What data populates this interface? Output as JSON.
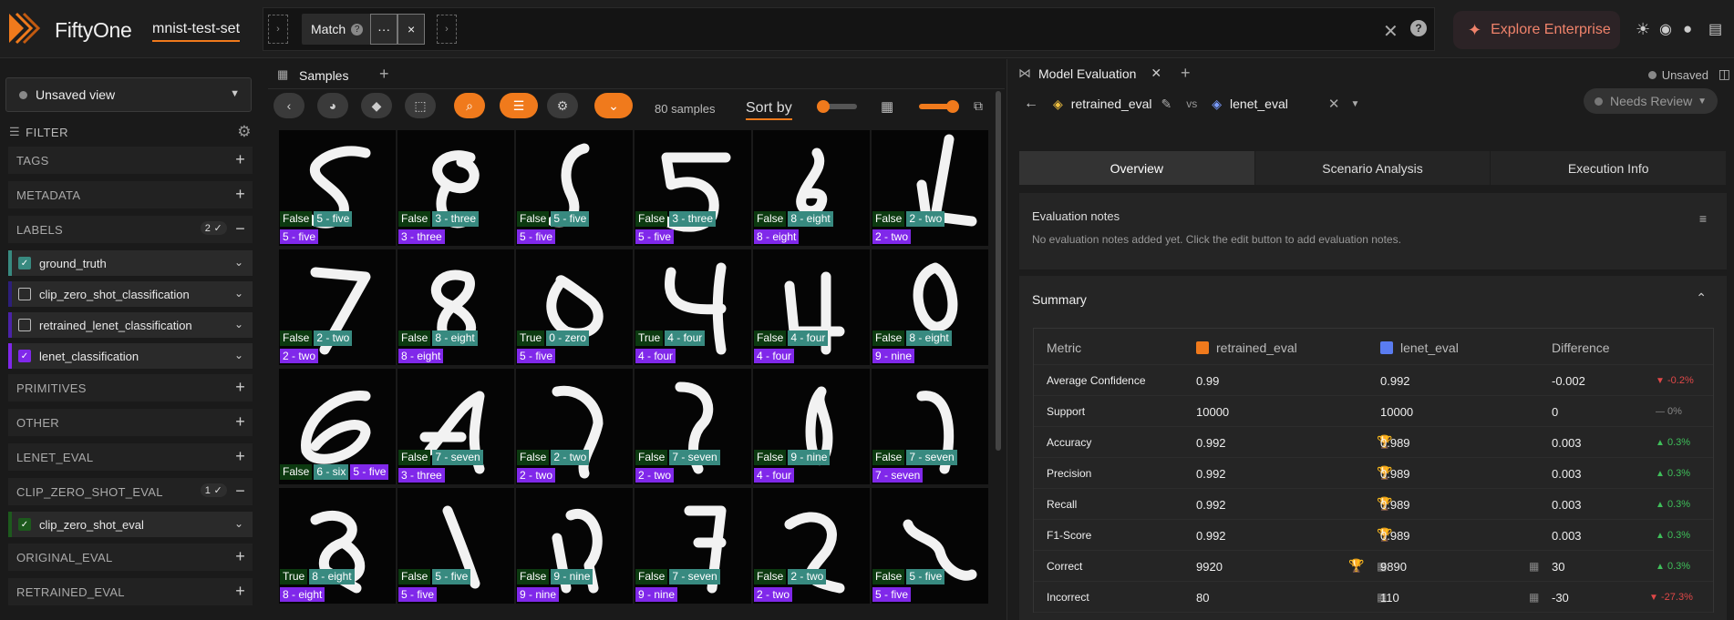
{
  "app": {
    "brand": "FiftyOne",
    "dataset": "mnist-test-set"
  },
  "topbar": {
    "match_label": "Match",
    "more": "···",
    "close": "×",
    "explore": "Explore Enterprise"
  },
  "sidebar": {
    "view": "Unsaved view",
    "filter_label": "FILTER",
    "groups": {
      "tags": "TAGS",
      "metadata": "METADATA",
      "labels": "LABELS",
      "labels_count": "2 ✓",
      "primitives": "PRIMITIVES",
      "other": "OTHER",
      "lenet_eval": "LENET_EVAL",
      "clip_zero_shot_eval": "CLIP_ZERO_SHOT_EVAL",
      "clip_count": "1 ✓",
      "original_eval": "ORIGINAL_EVAL",
      "retrained_eval": "RETRAINED_EVAL"
    },
    "fields": [
      "ground_truth",
      "clip_zero_shot_classification",
      "retrained_lenet_classification",
      "lenet_classification",
      "clip_zero_shot_eval"
    ]
  },
  "samples": {
    "tab": "Samples",
    "count": "80 samples",
    "sort_by": "Sort by"
  },
  "grid": [
    {
      "b": "False",
      "p": "5 - five",
      "g": "5 - five"
    },
    {
      "b": "False",
      "p": "3 - three",
      "g": "3 - three"
    },
    {
      "b": "False",
      "p": "5 - five",
      "g": "5 - five"
    },
    {
      "b": "False",
      "p": "3 - three",
      "g": "5 - five"
    },
    {
      "b": "False",
      "p": "8 - eight",
      "g": "8 - eight"
    },
    {
      "b": "False",
      "p": "2 - two",
      "g": "2 - two"
    },
    {
      "b": "False",
      "p": "2 - two",
      "g": "2 - two"
    },
    {
      "b": "False",
      "p": "8 - eight",
      "g": "8 - eight"
    },
    {
      "b": "True",
      "p": "0 - zero",
      "g": "5 - five"
    },
    {
      "b": "True",
      "p": "4 - four",
      "g": "4 - four"
    },
    {
      "b": "False",
      "p": "4 - four",
      "g": "4 - four"
    },
    {
      "b": "False",
      "p": "8 - eight",
      "g": "9 - nine"
    },
    {
      "b": "False",
      "p": "6 - six",
      "g": "5 - five",
      "inline": true
    },
    {
      "b": "False",
      "p": "7 - seven",
      "g": "3 - three"
    },
    {
      "b": "False",
      "p": "2 - two",
      "g": "2 - two"
    },
    {
      "b": "False",
      "p": "7 - seven",
      "g": "2 - two"
    },
    {
      "b": "False",
      "p": "9 - nine",
      "g": "4 - four"
    },
    {
      "b": "False",
      "p": "7 - seven",
      "g": "7 - seven"
    },
    {
      "b": "True",
      "p": "8 - eight",
      "g": "8 - eight"
    },
    {
      "b": "False",
      "p": "5 - five",
      "g": "5 - five"
    },
    {
      "b": "False",
      "p": "9 - nine",
      "g": "9 - nine"
    },
    {
      "b": "False",
      "p": "7 - seven",
      "g": "9 - nine"
    },
    {
      "b": "False",
      "p": "2 - two",
      "g": "2 - two"
    },
    {
      "b": "False",
      "p": "5 - five",
      "g": "5 - five"
    }
  ],
  "panel": {
    "tab": "Model Evaluation",
    "status": "Unsaved",
    "eval_a": "retrained_eval",
    "vs": "vs",
    "eval_b": "lenet_eval",
    "review": "Needs Review",
    "subtabs": [
      "Overview",
      "Scenario Analysis",
      "Execution Info"
    ],
    "notes_title": "Evaluation notes",
    "notes_text": "No evaluation notes added yet. Click the edit button to add evaluation notes.",
    "summary_title": "Summary",
    "columns": [
      "Metric",
      "retrained_eval",
      "lenet_eval",
      "Difference"
    ],
    "colors": {
      "a": "#f07a1c",
      "b": "#5a7cf0"
    },
    "rows": [
      {
        "m": "Average Confidence",
        "a": "0.99",
        "b": "0.992",
        "d": "-0.002",
        "dp": "-0.2%",
        "dir": "down"
      },
      {
        "m": "Support",
        "a": "10000",
        "b": "10000",
        "d": "0",
        "dp": "0%",
        "dir": "flat"
      },
      {
        "m": "Accuracy",
        "a": "0.992",
        "b": "0.989",
        "d": "0.003",
        "dp": "0.3%",
        "dir": "up",
        "win": true
      },
      {
        "m": "Precision",
        "a": "0.992",
        "b": "0.989",
        "d": "0.003",
        "dp": "0.3%",
        "dir": "up",
        "win": true
      },
      {
        "m": "Recall",
        "a": "0.992",
        "b": "0.989",
        "d": "0.003",
        "dp": "0.3%",
        "dir": "up",
        "win": true
      },
      {
        "m": "F1-Score",
        "a": "0.992",
        "b": "0.989",
        "d": "0.003",
        "dp": "0.3%",
        "dir": "up",
        "win": true
      },
      {
        "m": "Correct",
        "a": "9920",
        "b": "9890",
        "d": "30",
        "dp": "0.3%",
        "dir": "up",
        "win": true,
        "grid": true
      },
      {
        "m": "Incorrect",
        "a": "80",
        "b": "110",
        "d": "-30",
        "dp": "-27.3%",
        "dir": "down",
        "grid": true
      }
    ]
  }
}
